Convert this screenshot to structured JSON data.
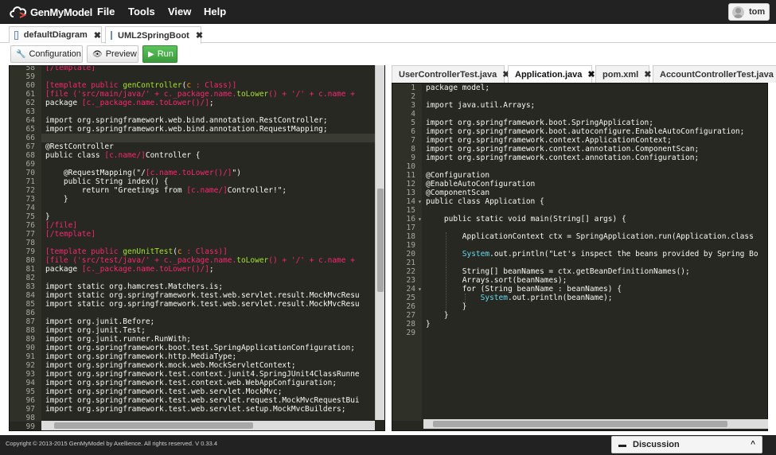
{
  "app": {
    "logo_text": "GenMyModel",
    "menu": [
      "File",
      "Tools",
      "View",
      "Help"
    ],
    "user": "tom"
  },
  "doc_tabs": [
    {
      "label": "defaultDiagram",
      "active": false
    },
    {
      "label": "UML2SpringBoot",
      "active": true
    }
  ],
  "toolbar": {
    "configuration": "Configuration",
    "preview": "Preview",
    "run": "Run"
  },
  "left_editor": {
    "current_line": 66,
    "lines": [
      {
        "n": "58",
        "t": [
          [
            "[/template]",
            "d"
          ]
        ]
      },
      {
        "n": "59",
        "t": []
      },
      {
        "n": "60",
        "t": [
          [
            "[template ",
            "d"
          ],
          [
            "public",
            "d"
          ],
          [
            " ",
            ""
          ],
          [
            "genController",
            "f"
          ],
          [
            "(",
            ""
          ],
          [
            "c",
            "i"
          ],
          [
            " : Class)]",
            "d"
          ]
        ]
      },
      {
        "n": "61",
        "t": [
          [
            "[file ('src/main/java/' + c._package.name.",
            "d"
          ],
          [
            "toLower",
            "f"
          ],
          [
            "() + '/' + c.name + ",
            "d"
          ]
        ]
      },
      {
        "n": "62",
        "t": [
          [
            "package ",
            ""
          ],
          [
            "[c._package.name.toLower()/]",
            "d"
          ],
          [
            ";",
            ""
          ]
        ]
      },
      {
        "n": "63",
        "t": []
      },
      {
        "n": "64",
        "t": [
          [
            "import org.springframework.web.bind.annotation.RestController;",
            ""
          ]
        ]
      },
      {
        "n": "65",
        "t": [
          [
            "import org.springframework.web.bind.annotation.RequestMapping;",
            ""
          ]
        ]
      },
      {
        "n": "66",
        "t": []
      },
      {
        "n": "67",
        "t": [
          [
            "@RestController",
            ""
          ]
        ]
      },
      {
        "n": "68",
        "t": [
          [
            "public class ",
            ""
          ],
          [
            "[c.name/]",
            "d"
          ],
          [
            "Controller {",
            ""
          ]
        ]
      },
      {
        "n": "69",
        "t": []
      },
      {
        "n": "70",
        "t": [
          [
            "    @RequestMapping(\"/",
            ""
          ],
          [
            "[c.name.toLower()/]",
            "d"
          ],
          [
            "\")",
            ""
          ]
        ]
      },
      {
        "n": "71",
        "t": [
          [
            "    public String index() {",
            ""
          ]
        ]
      },
      {
        "n": "72",
        "t": [
          [
            "        return \"Greetings from ",
            ""
          ],
          [
            "[c.name/]",
            "d"
          ],
          [
            "Controller!\";",
            ""
          ]
        ]
      },
      {
        "n": "73",
        "t": [
          [
            "    }",
            ""
          ]
        ]
      },
      {
        "n": "74",
        "t": []
      },
      {
        "n": "75",
        "t": [
          [
            "}",
            ""
          ]
        ]
      },
      {
        "n": "76",
        "t": [
          [
            "[/file]",
            "d"
          ]
        ]
      },
      {
        "n": "77",
        "t": [
          [
            "[/template]",
            "d"
          ]
        ]
      },
      {
        "n": "78",
        "t": []
      },
      {
        "n": "79",
        "t": [
          [
            "[template ",
            "d"
          ],
          [
            "public",
            "d"
          ],
          [
            " ",
            ""
          ],
          [
            "genUnitTest",
            "f"
          ],
          [
            "(",
            ""
          ],
          [
            "c",
            "i"
          ],
          [
            " : Class)]",
            "d"
          ]
        ]
      },
      {
        "n": "80",
        "t": [
          [
            "[file ('src/test/java/' + c._package.name.",
            "d"
          ],
          [
            "toLower",
            "f"
          ],
          [
            "() + '/' + c.name + ",
            "d"
          ]
        ]
      },
      {
        "n": "81",
        "t": [
          [
            "package ",
            ""
          ],
          [
            "[c._package.name.toLower()/]",
            "d"
          ],
          [
            ";",
            ""
          ]
        ]
      },
      {
        "n": "82",
        "t": []
      },
      {
        "n": "83",
        "t": [
          [
            "import static org.hamcrest.Matchers.is;",
            ""
          ]
        ]
      },
      {
        "n": "84",
        "t": [
          [
            "import static org.springframework.test.web.servlet.result.MockMvcResu",
            ""
          ]
        ]
      },
      {
        "n": "85",
        "t": [
          [
            "import static org.springframework.test.web.servlet.result.MockMvcResu",
            ""
          ]
        ]
      },
      {
        "n": "86",
        "t": []
      },
      {
        "n": "87",
        "t": [
          [
            "import org.junit.Before;",
            ""
          ]
        ]
      },
      {
        "n": "88",
        "t": [
          [
            "import org.junit.Test;",
            ""
          ]
        ]
      },
      {
        "n": "89",
        "t": [
          [
            "import org.junit.runner.RunWith;",
            ""
          ]
        ]
      },
      {
        "n": "90",
        "t": [
          [
            "import org.springframework.boot.test.SpringApplicationConfiguration;",
            ""
          ]
        ]
      },
      {
        "n": "91",
        "t": [
          [
            "import org.springframework.http.MediaType;",
            ""
          ]
        ]
      },
      {
        "n": "92",
        "t": [
          [
            "import org.springframework.mock.web.MockServletContext;",
            ""
          ]
        ]
      },
      {
        "n": "93",
        "t": [
          [
            "import org.springframework.test.context.junit4.SpringJUnit4ClassRunne",
            ""
          ]
        ]
      },
      {
        "n": "94",
        "t": [
          [
            "import org.springframework.test.context.web.WebAppConfiguration;",
            ""
          ]
        ]
      },
      {
        "n": "95",
        "t": [
          [
            "import org.springframework.test.web.servlet.MockMvc;",
            ""
          ]
        ]
      },
      {
        "n": "96",
        "t": [
          [
            "import org.springframework.test.web.servlet.request.MockMvcRequestBui",
            ""
          ]
        ]
      },
      {
        "n": "97",
        "t": [
          [
            "import org.springframework.test.web.servlet.setup.MockMvcBuilders;",
            ""
          ]
        ]
      },
      {
        "n": "98",
        "t": []
      },
      {
        "n": "99",
        "t": []
      }
    ]
  },
  "file_tabs": [
    {
      "label": "UserControllerTest.java",
      "active": false
    },
    {
      "label": "Application.java",
      "active": true
    },
    {
      "label": "pom.xml",
      "active": false
    },
    {
      "label": "AccountControllerTest.java",
      "active": false
    }
  ],
  "right_editor": {
    "lines": [
      {
        "n": "1",
        "t": [
          [
            "package model;",
            ""
          ]
        ]
      },
      {
        "n": "2",
        "t": []
      },
      {
        "n": "3",
        "t": [
          [
            "import java.util.Arrays;",
            ""
          ]
        ]
      },
      {
        "n": "4",
        "t": []
      },
      {
        "n": "5",
        "t": [
          [
            "import org.springframework.boot.SpringApplication;",
            ""
          ]
        ]
      },
      {
        "n": "6",
        "t": [
          [
            "import org.springframework.boot.autoconfigure.EnableAutoConfiguration;",
            ""
          ]
        ]
      },
      {
        "n": "7",
        "t": [
          [
            "import org.springframework.context.ApplicationContext;",
            ""
          ]
        ]
      },
      {
        "n": "8",
        "t": [
          [
            "import org.springframework.context.annotation.ComponentScan;",
            ""
          ]
        ]
      },
      {
        "n": "9",
        "t": [
          [
            "import org.springframework.context.annotation.Configuration;",
            ""
          ]
        ]
      },
      {
        "n": "10",
        "t": []
      },
      {
        "n": "11",
        "t": [
          [
            "@Configuration",
            ""
          ]
        ]
      },
      {
        "n": "12",
        "t": [
          [
            "@EnableAutoConfiguration",
            ""
          ]
        ]
      },
      {
        "n": "13",
        "t": [
          [
            "@ComponentScan",
            ""
          ]
        ]
      },
      {
        "n": "14",
        "fold": true,
        "t": [
          [
            "public class Application {",
            ""
          ]
        ]
      },
      {
        "n": "15",
        "t": []
      },
      {
        "n": "16",
        "fold": true,
        "t": [
          [
            "    public static void main(String[] args) {",
            ""
          ]
        ]
      },
      {
        "n": "17",
        "t": []
      },
      {
        "n": "18",
        "t": [
          [
            "        ApplicationContext ctx = SpringApplication.run(Application.class",
            ""
          ]
        ]
      },
      {
        "n": "19",
        "t": []
      },
      {
        "n": "20",
        "t": [
          [
            "        ",
            ""
          ],
          [
            "System",
            "b"
          ],
          [
            ".out.println(\"Let's inspect the beans provided by Spring Bo",
            ""
          ]
        ]
      },
      {
        "n": "21",
        "t": []
      },
      {
        "n": "22",
        "t": [
          [
            "        String[] beanNames = ctx.getBeanDefinitionNames();",
            ""
          ]
        ]
      },
      {
        "n": "23",
        "t": [
          [
            "        Arrays.sort(beanNames);",
            ""
          ]
        ]
      },
      {
        "n": "24",
        "fold": true,
        "t": [
          [
            "        for (String beanName : beanNames) {",
            ""
          ]
        ]
      },
      {
        "n": "25",
        "t": [
          [
            "            ",
            ""
          ],
          [
            "System",
            "b"
          ],
          [
            ".out.println(beanName);",
            ""
          ]
        ]
      },
      {
        "n": "26",
        "t": [
          [
            "        }",
            ""
          ]
        ]
      },
      {
        "n": "27",
        "t": [
          [
            "    }",
            ""
          ]
        ]
      },
      {
        "n": "28",
        "t": [
          [
            "}",
            ""
          ]
        ]
      },
      {
        "n": "29",
        "t": []
      }
    ]
  },
  "footer": {
    "copyright": "Copyright © 2013-2015 GenMyModel by Axellience. All rights reserved.  V 0.33.4",
    "discussion": "Discussion"
  },
  "colors": {
    "topbar": "#222222",
    "editor_bg": "#272822",
    "gutter_bg": "#2f3129",
    "template_tag": "#f92672",
    "string": "#e6db74",
    "function": "#a6e22e",
    "param": "#fd971f",
    "system": "#66d9ef",
    "run_button": "#3a9a3a"
  },
  "icons": {
    "logo": "cloud-logo-icon",
    "doc_tab": "diagram-icon",
    "configuration": "wrench-icon",
    "preview": "eye-icon",
    "run": "play-icon",
    "discussion": "chat-icon",
    "expand": "chevron-up-icon",
    "close": "close-icon"
  }
}
